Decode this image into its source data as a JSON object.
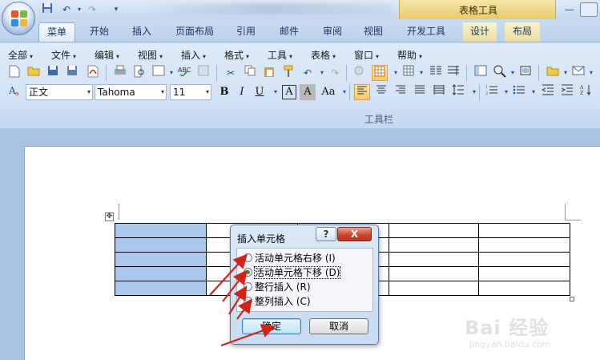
{
  "titlebar": {
    "context_title": "表格工具",
    "quick_access": [
      "save-icon",
      "undo-icon",
      "redo-icon",
      "customize-icon"
    ],
    "window_controls": [
      "minimize-icon",
      "restore-icon"
    ]
  },
  "tabs": [
    {
      "label": "菜单",
      "active": true
    },
    {
      "label": "开始"
    },
    {
      "label": "插入"
    },
    {
      "label": "页面布局"
    },
    {
      "label": "引用"
    },
    {
      "label": "邮件"
    },
    {
      "label": "审阅"
    },
    {
      "label": "视图"
    },
    {
      "label": "开发工具"
    },
    {
      "label": "设计",
      "contextual": true
    },
    {
      "label": "布局",
      "contextual": true
    }
  ],
  "menubar": {
    "items": [
      "全部",
      "文件",
      "编辑",
      "视图",
      "插入",
      "格式",
      "工具",
      "表格",
      "窗口",
      "帮助"
    ]
  },
  "formatting": {
    "style": "正文",
    "font": "Tahoma",
    "size": "11",
    "bold": "B",
    "italic": "I",
    "underline": "U",
    "char_border": "A",
    "char_shade": "A",
    "change_case": "Aa"
  },
  "ribbon": {
    "group_label": "工具栏"
  },
  "dialog": {
    "title": "插入单元格",
    "help": "?",
    "close": "X",
    "options": [
      {
        "label": "活动单元格右移 (I)",
        "checked": false
      },
      {
        "label": "活动单元格下移 (D)",
        "checked": true
      },
      {
        "label": "整行插入 (R)",
        "checked": false
      },
      {
        "label": "整列插入 (C)",
        "checked": false
      }
    ],
    "ok": "确定",
    "cancel": "取消"
  },
  "watermark": {
    "brand": "Bai 经验",
    "url": "jingyan.baidu.com"
  },
  "colors": {
    "selected_cell": "#abc9ea",
    "annotation_arrow": "#d0241b",
    "radio_checked": "#1f9e2b",
    "dialog_close": "#c9472f"
  }
}
